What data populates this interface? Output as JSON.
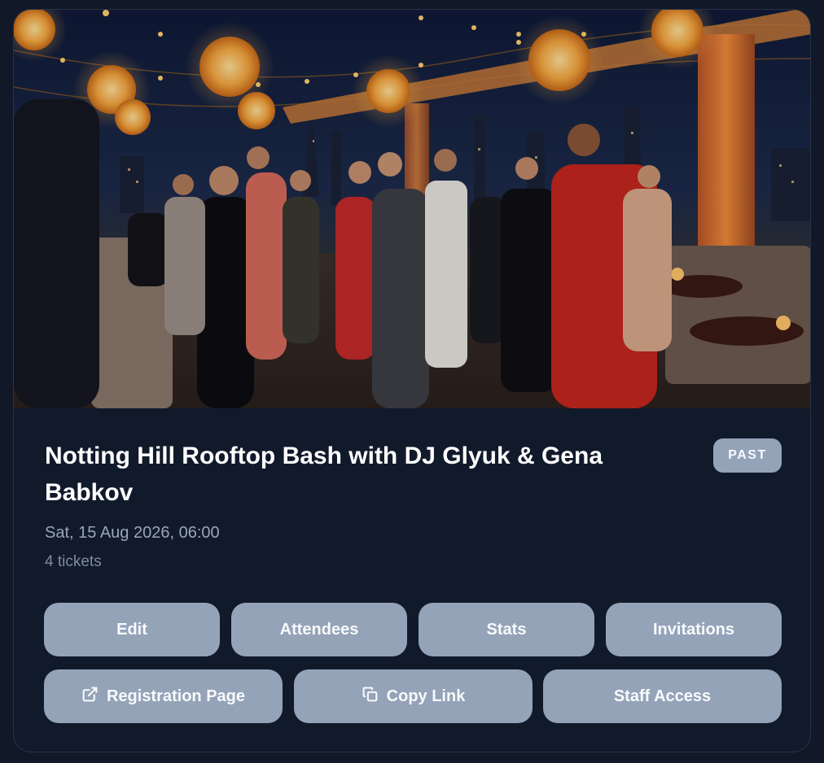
{
  "event": {
    "image_alt": "Rooftop party at night with lanterns and city skyline",
    "title": "Notting Hill Rooftop Bash with DJ Glyuk & Gena Babkov",
    "status_badge": "PAST",
    "datetime": "Sat, 15 Aug 2026, 06:00",
    "tickets": "4 tickets"
  },
  "actions": {
    "row1": [
      {
        "label": "Edit"
      },
      {
        "label": "Attendees"
      },
      {
        "label": "Stats"
      },
      {
        "label": "Invitations"
      }
    ],
    "row2": [
      {
        "label": "Registration Page",
        "icon": "external-link-icon"
      },
      {
        "label": "Copy Link",
        "icon": "copy-icon"
      },
      {
        "label": "Staff Access"
      }
    ]
  },
  "colors": {
    "background": "#111827",
    "card": "#111a2b",
    "button": "#94a3b8",
    "title_text": "#ffffff",
    "muted_text": "#9aa5b5"
  }
}
